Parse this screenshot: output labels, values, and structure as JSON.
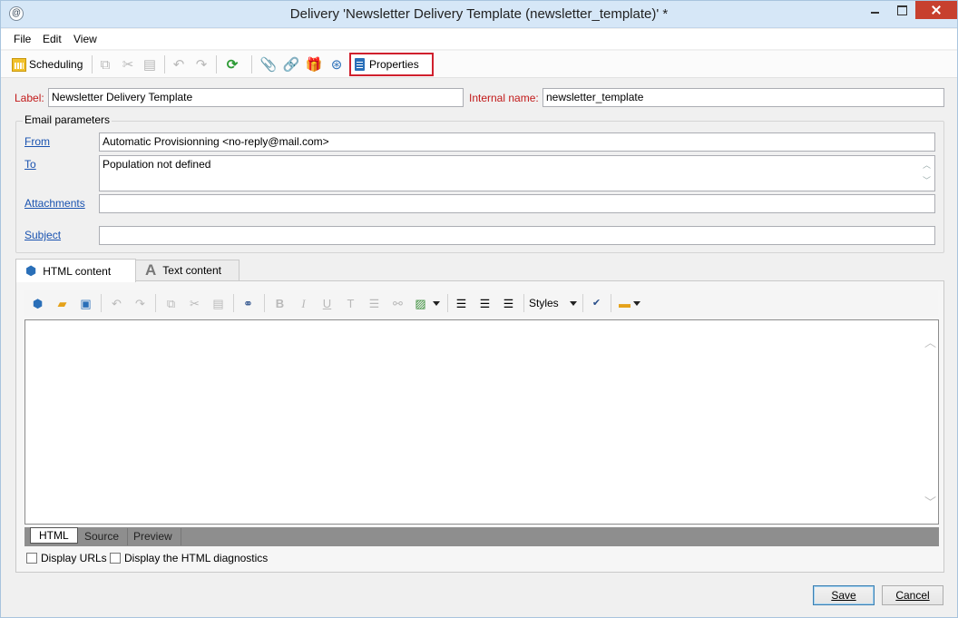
{
  "window": {
    "title": "Delivery 'Newsletter Delivery Template (newsletter_template)' *"
  },
  "menu": {
    "file": "File",
    "edit": "Edit",
    "view": "View"
  },
  "toolbar": {
    "scheduling_label": "Scheduling",
    "properties_label": "Properties",
    "highlight_color": "#d0202d"
  },
  "form": {
    "label_caption": "Label:",
    "label_value": "Newsletter Delivery Template",
    "internal_name_caption": "Internal name:",
    "internal_name_value": "newsletter_template"
  },
  "email_params": {
    "group_title": "Email parameters",
    "from_label": "From",
    "from_value": "Automatic Provisionning <no-reply@mail.com>",
    "to_label": "To",
    "to_value": "Population not defined",
    "attachments_label": "Attachments",
    "attachments_value": "",
    "subject_label": "Subject",
    "subject_value": ""
  },
  "content_tabs": {
    "html_tab": "HTML content",
    "text_tab": "Text content"
  },
  "editor": {
    "styles_label": "Styles",
    "bold": "B",
    "italic": "I",
    "underline": "U"
  },
  "view_tabs": {
    "html": "HTML",
    "source": "Source",
    "preview": "Preview"
  },
  "options": {
    "display_urls": "Display URLs",
    "display_urls_checked": false,
    "html_diagnostics": "Display the HTML diagnostics",
    "html_diagnostics_checked": false
  },
  "buttons": {
    "save": "Save",
    "cancel": "Cancel"
  }
}
